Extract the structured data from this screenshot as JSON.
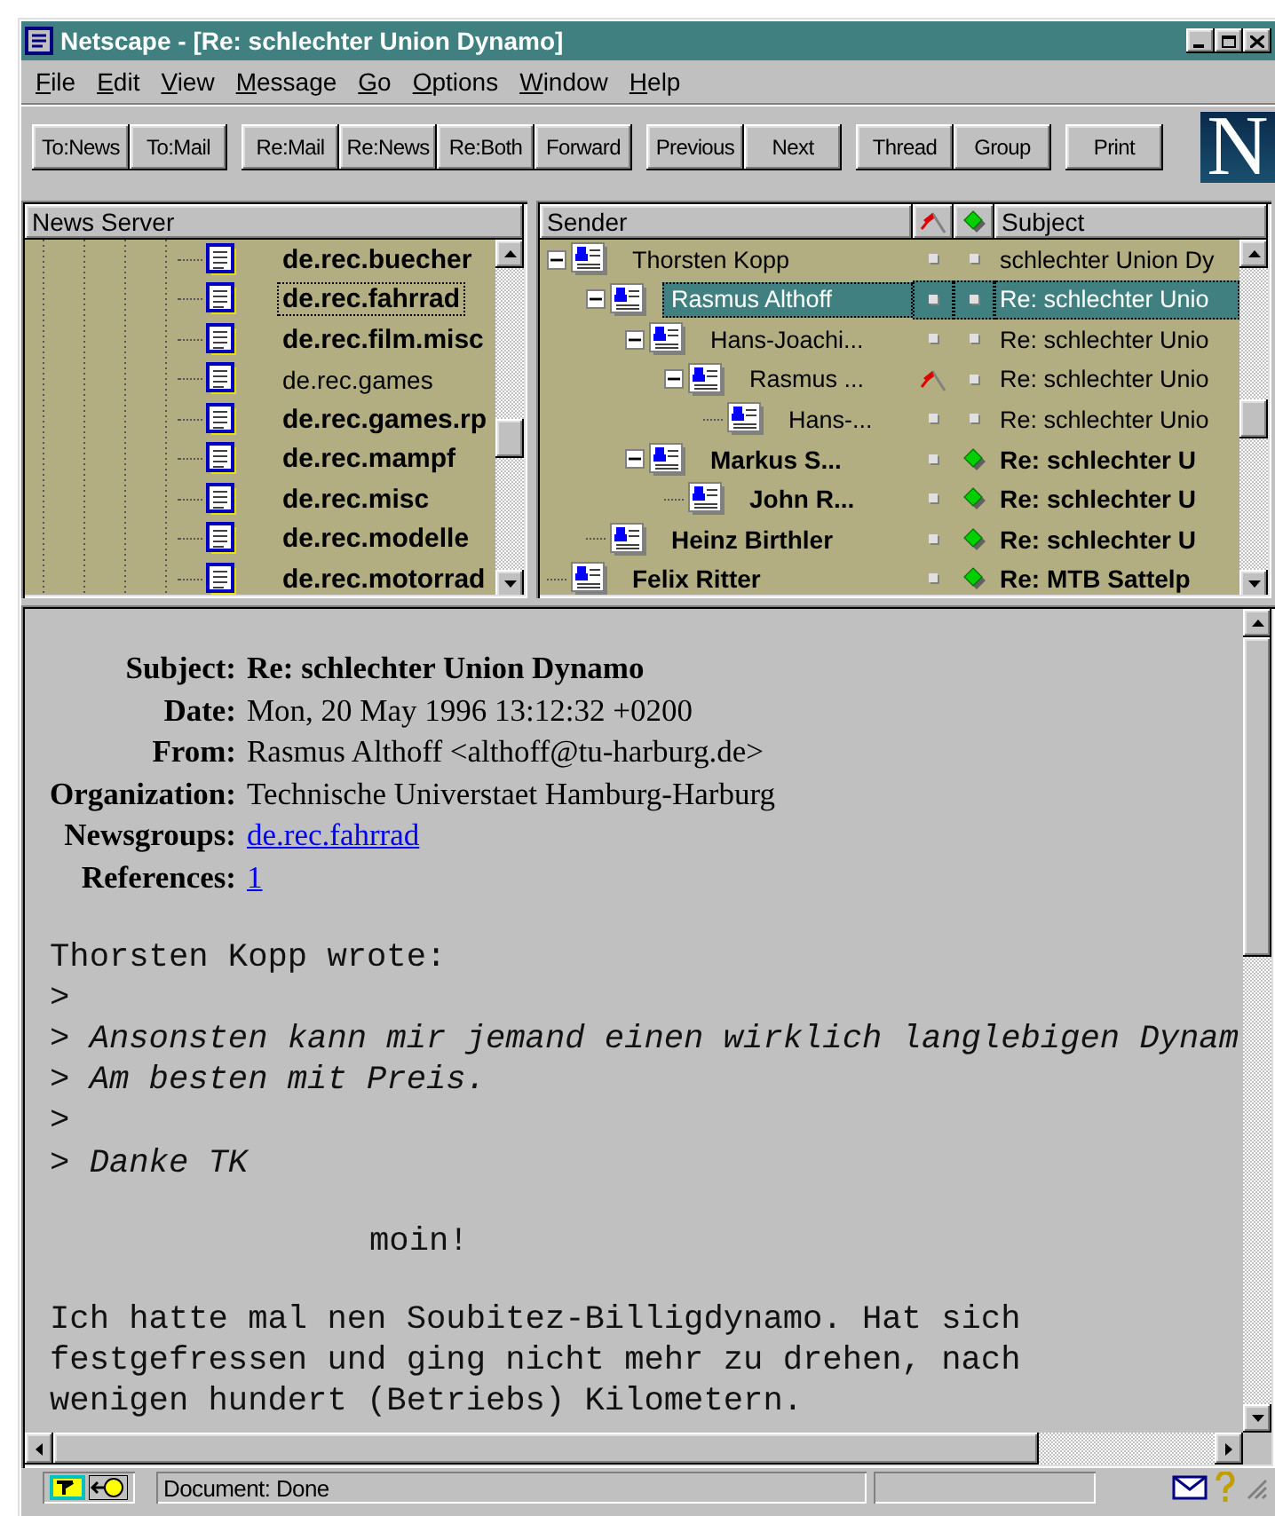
{
  "window": {
    "title": "Netscape - [Re: schlechter Union Dynamo]"
  },
  "menu": [
    "File",
    "Edit",
    "View",
    "Message",
    "Go",
    "Options",
    "Window",
    "Help"
  ],
  "toolbar": {
    "groups": [
      [
        "To:News",
        "To:Mail"
      ],
      [
        "Re:Mail",
        "Re:News",
        "Re:Both",
        "Forward"
      ],
      [
        "Previous",
        "Next"
      ],
      [
        "Thread",
        "Group"
      ],
      [
        "Print"
      ]
    ],
    "logo": "N"
  },
  "news_server": {
    "header": "News Server",
    "groups": [
      {
        "name": "de.rec.buecher",
        "unread": true,
        "focused": false
      },
      {
        "name": "de.rec.fahrrad",
        "unread": true,
        "focused": true
      },
      {
        "name": "de.rec.film.misc",
        "unread": true,
        "focused": false
      },
      {
        "name": "de.rec.games",
        "unread": false,
        "focused": false
      },
      {
        "name": "de.rec.games.rp",
        "unread": true,
        "focused": false
      },
      {
        "name": "de.rec.mampf",
        "unread": true,
        "focused": false
      },
      {
        "name": "de.rec.misc",
        "unread": true,
        "focused": false
      },
      {
        "name": "de.rec.modelle",
        "unread": true,
        "focused": false
      },
      {
        "name": "de.rec.motorrad",
        "unread": true,
        "focused": false
      }
    ]
  },
  "threads": {
    "sender_header": "Sender",
    "subject_header": "Subject",
    "messages": [
      {
        "sender": "Thorsten Kopp",
        "subject": "schlechter Union Dy",
        "flagged": false,
        "unread": false,
        "selected": false,
        "expanded": true,
        "children": [
          {
            "sender": "Rasmus Althoff",
            "subject": "Re: schlechter Unio",
            "flagged": false,
            "unread": false,
            "selected": true,
            "expanded": true,
            "children": [
              {
                "sender": "Hans-Joachi...",
                "subject": "Re: schlechter Unio",
                "flagged": false,
                "unread": false,
                "selected": false,
                "expanded": true,
                "children": [
                  {
                    "sender": "Rasmus ...",
                    "subject": "Re: schlechter Unio",
                    "flagged": true,
                    "unread": false,
                    "selected": false,
                    "expanded": true,
                    "children": [
                      {
                        "sender": "Hans-...",
                        "subject": "Re: schlechter Unio",
                        "flagged": false,
                        "unread": false,
                        "selected": false
                      }
                    ]
                  }
                ]
              },
              {
                "sender": "Markus S...",
                "subject": "Re: schlechter U",
                "flagged": false,
                "unread": true,
                "selected": false,
                "expanded": true,
                "children": [
                  {
                    "sender": "John R...",
                    "subject": "Re: schlechter U",
                    "flagged": false,
                    "unread": true,
                    "selected": false
                  }
                ]
              }
            ]
          },
          {
            "sender": "Heinz Birthler",
            "subject": "Re: schlechter U",
            "flagged": false,
            "unread": true,
            "selected": false
          }
        ]
      },
      {
        "sender": "Felix Ritter",
        "subject": "Re: MTB Sattelp",
        "flagged": false,
        "unread": true,
        "selected": false
      }
    ]
  },
  "message": {
    "headers": [
      {
        "label": "Subject:",
        "value": "Re: schlechter Union Dynamo",
        "kind": "bold"
      },
      {
        "label": "Date:",
        "value": "Mon, 20 May 1996 13:12:32 +0200",
        "kind": "plain"
      },
      {
        "label": "From:",
        "value": "Rasmus Althoff <althoff@tu-harburg.de>",
        "kind": "plain"
      },
      {
        "label": "Organization:",
        "value": "Technische Universtaet Hamburg-Harburg",
        "kind": "plain"
      },
      {
        "label": "Newsgroups:",
        "value": "de.rec.fahrrad",
        "kind": "link"
      },
      {
        "label": "References:",
        "value": "1",
        "kind": "link"
      }
    ],
    "body": [
      {
        "kind": "plain",
        "text": "Thorsten Kopp wrote:"
      },
      {
        "kind": "quote",
        "text": ">"
      },
      {
        "kind": "quote",
        "text": "> Ansonsten kann mir jemand einen wirklich langlebigen Dynam"
      },
      {
        "kind": "quote",
        "text": "> Am besten mit Preis."
      },
      {
        "kind": "quote",
        "text": ">"
      },
      {
        "kind": "quote",
        "text": "> Danke TK"
      },
      {
        "kind": "blank"
      },
      {
        "kind": "indent",
        "text": "moin!"
      },
      {
        "kind": "blank"
      },
      {
        "kind": "plain",
        "text": "Ich hatte mal nen Soubitez-Billigdynamo. Hat sich"
      },
      {
        "kind": "plain",
        "text": "festgefressen und ging nicht mehr zu drehen, nach"
      },
      {
        "kind": "plain",
        "text": "wenigen hundert (Betriebs) Kilometern."
      }
    ]
  },
  "status_bar": {
    "text": "Document: Done"
  }
}
